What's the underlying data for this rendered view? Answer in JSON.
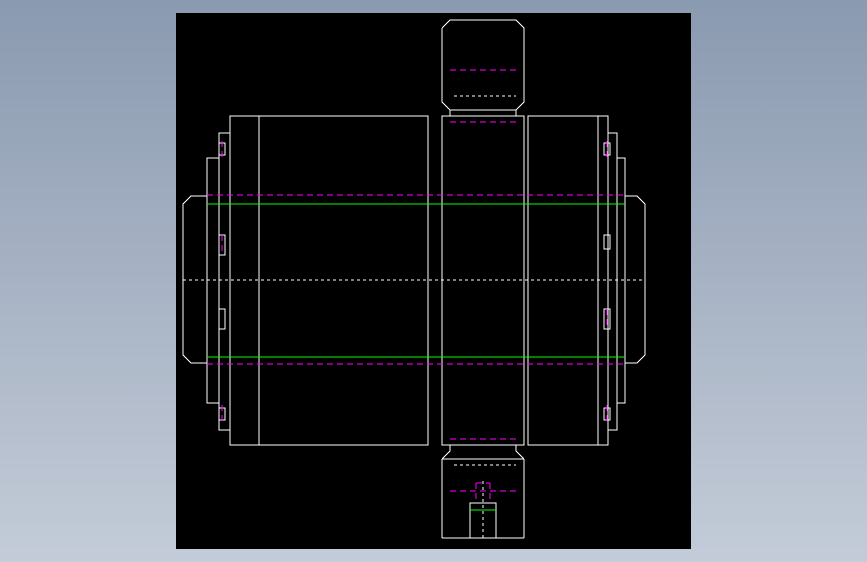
{
  "drawing": {
    "background": "#000000",
    "colors": {
      "outline": "#ffffff",
      "hidden": "#ff00ff",
      "pitch": "#00ff00",
      "center": "#ffffff"
    }
  }
}
